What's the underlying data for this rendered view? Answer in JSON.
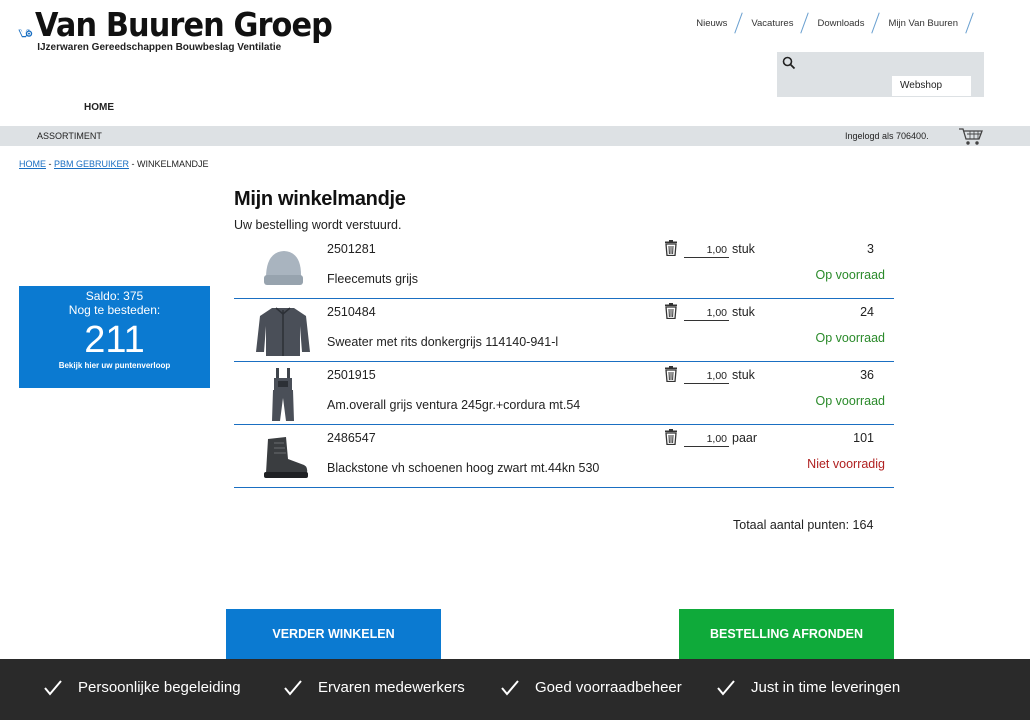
{
  "header": {
    "logo_title": "Van Buuren Groep",
    "logo_subtitle": "IJzerwaren Gereedschappen Bouwbeslag Ventilatie",
    "topnav": [
      "Nieuws",
      "Vacatures",
      "Downloads",
      "Mijn Van Buuren"
    ],
    "search": {
      "placeholder": "",
      "webshop_label": "Webshop"
    },
    "home_label": "HOME"
  },
  "menubar": {
    "assortiment_label": "ASSORTIMENT",
    "login_text": "Ingelogd als 706400."
  },
  "breadcrumb": {
    "home": "HOME",
    "sep": " - ",
    "pbm": "PBM GEBRUIKER",
    "current": "WINKELMANDJE"
  },
  "saldo": {
    "saldo_text": "Saldo: 375",
    "nog_label": "Nog te besteden:",
    "amount": "211",
    "link": "Bekijk hier uw puntenverloop"
  },
  "cart": {
    "title": "Mijn winkelmandje",
    "status": "Uw bestelling wordt verstuurd.",
    "items": [
      {
        "code": "2501281",
        "name": "Fleecemuts grijs",
        "qty": "1,00",
        "unit": "stuk",
        "points": "3",
        "stock": "Op voorraad",
        "in_stock": true,
        "thumb_icon": "beanie-icon"
      },
      {
        "code": "2510484",
        "name": "Sweater met rits donkergrijs 114140-941-l",
        "qty": "1,00",
        "unit": "stuk",
        "points": "24",
        "stock": "Op voorraad",
        "in_stock": true,
        "thumb_icon": "sweater-icon"
      },
      {
        "code": "2501915",
        "name": "Am.overall grijs ventura 245gr.+cordura mt.54",
        "qty": "1,00",
        "unit": "stuk",
        "points": "36",
        "stock": "Op voorraad",
        "in_stock": true,
        "thumb_icon": "overall-icon"
      },
      {
        "code": "2486547",
        "name": "Blackstone vh schoenen hoog zwart mt.44kn 530",
        "qty": "1,00",
        "unit": "paar",
        "points": "101",
        "stock": "Niet voorradig",
        "in_stock": false,
        "thumb_icon": "boot-icon"
      }
    ],
    "total": "Totaal aantal punten: 164"
  },
  "actions": {
    "continue_label": "VERDER WINKELEN",
    "finish_label": "BESTELLING AFRONDEN"
  },
  "footer": {
    "features": [
      "Persoonlijke begeleiding",
      "Ervaren medewerkers",
      "Goed voorraadbeheer",
      "Just in time leveringen"
    ]
  },
  "colors": {
    "primary_blue": "#0b7ad1",
    "finish_green": "#0faa3a",
    "stock_ok": "#2a8a2a",
    "stock_no": "#b02020",
    "footer_bg": "#2a2a2a",
    "bar_grey": "#dde1e4"
  }
}
